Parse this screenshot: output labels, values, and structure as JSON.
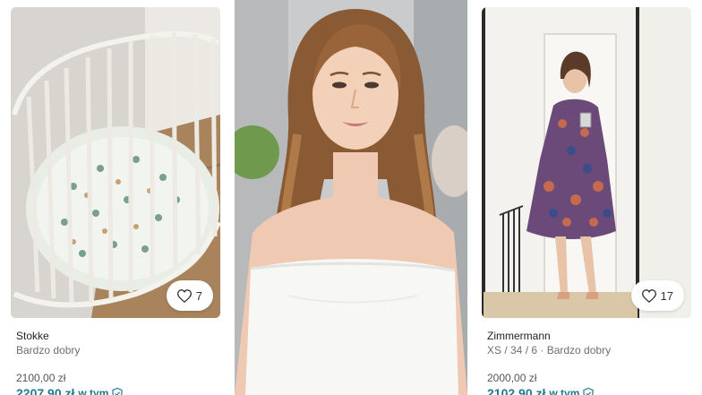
{
  "colors": {
    "accent": "#1e7a8e",
    "text_primary": "#222222",
    "text_secondary": "#6f6f6f"
  },
  "listings": [
    {
      "brand": "Stokke",
      "details": "Bardzo dobry",
      "price": "2100,00 zł",
      "total_price": "2207,90 zł",
      "total_note": "w tym",
      "favorites": "7",
      "favorite_icon": "heart-icon",
      "protection_icon": "shield-check-icon",
      "photo_subject": "crib"
    },
    {
      "brand": "Zimmermann",
      "details": "XS / 34 / 6 · Bardzo dobry",
      "price": "2000,00 zł",
      "total_price": "2102,90 zł",
      "total_note": "w tym",
      "favorites": "17",
      "favorite_icon": "heart-icon",
      "protection_icon": "shield-check-icon",
      "photo_subject": "dress"
    }
  ]
}
